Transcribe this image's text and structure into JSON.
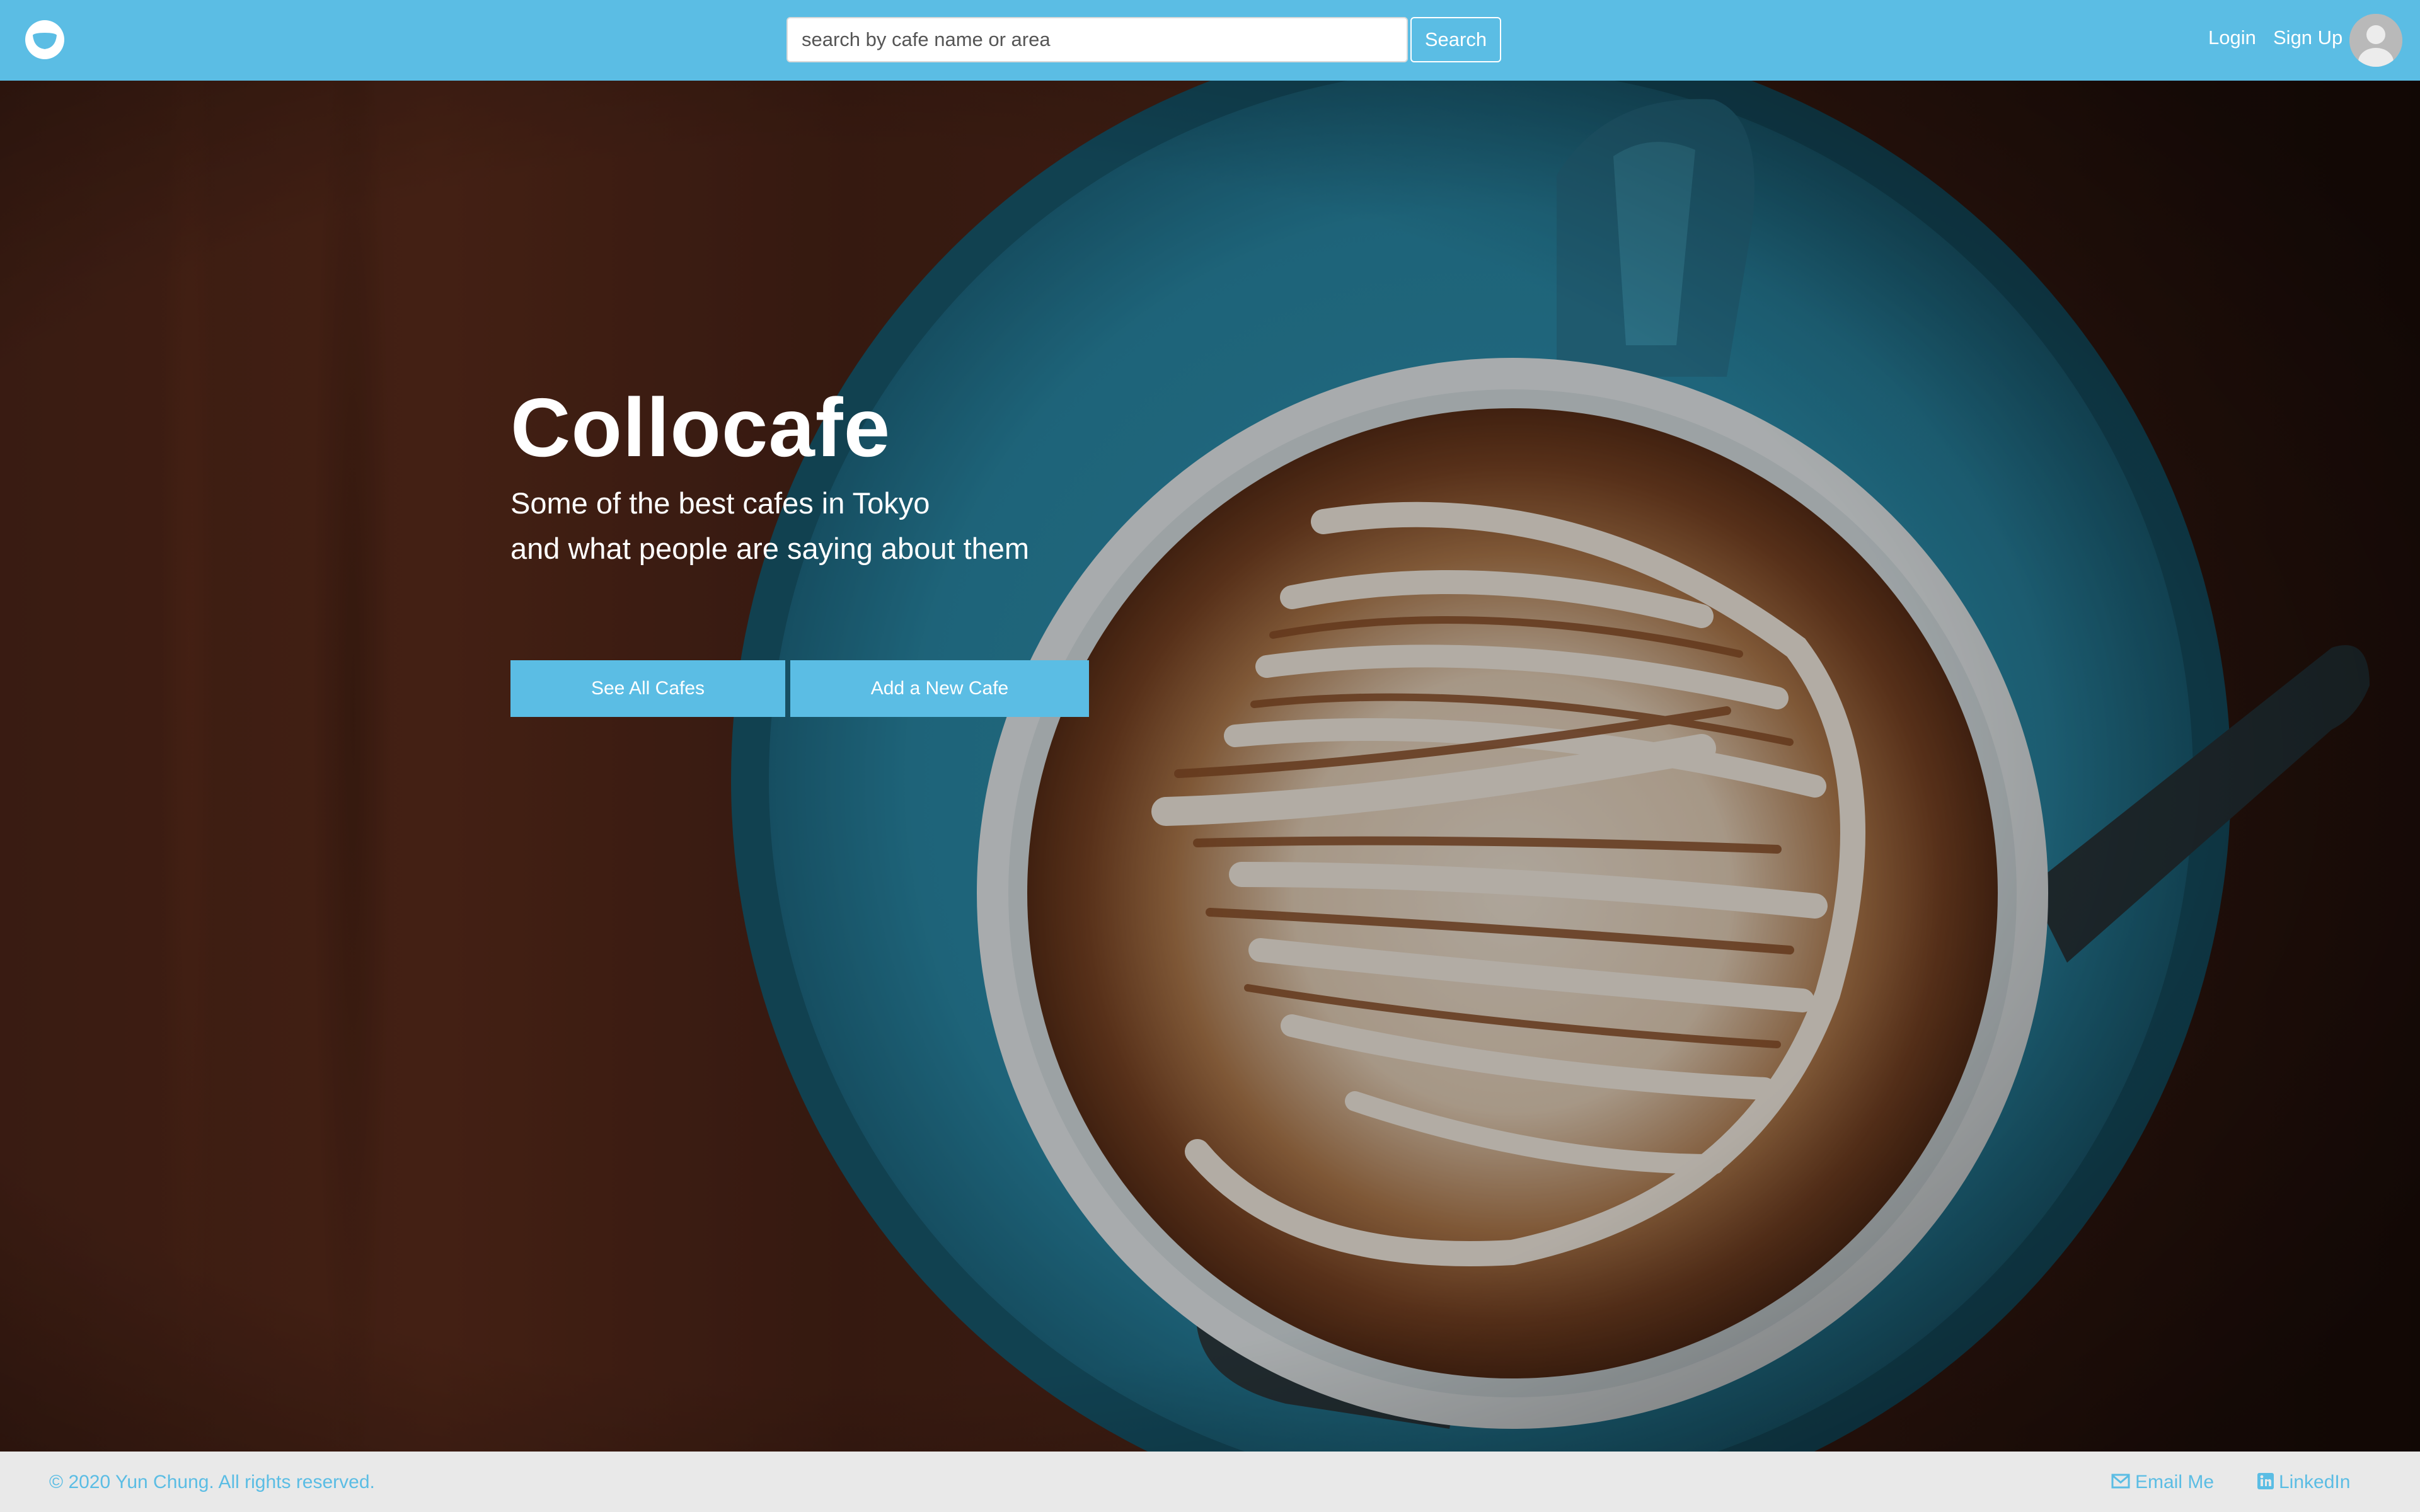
{
  "navbar": {
    "logo_icon": "coffee-cup-icon",
    "search": {
      "placeholder": "search by cafe name or area",
      "value": "",
      "button_label": "Search"
    },
    "login_label": "Login",
    "signup_label": "Sign Up",
    "avatar_icon": "user-avatar-icon"
  },
  "hero": {
    "background": "latte-art-coffee-cup-photo",
    "title": "Collocafe",
    "subtitle_line1": "Some of the best cafes in Tokyo",
    "subtitle_line2": "and what people are saying about them",
    "see_all_label": "See All Cafes",
    "add_new_label": "Add a New Cafe"
  },
  "footer": {
    "copyright": "© 2020 Yun Chung. All rights reserved.",
    "email_label": "Email Me",
    "email_icon": "envelope-icon",
    "linkedin_label": "LinkedIn",
    "linkedin_icon": "linkedin-icon"
  },
  "colors": {
    "accent": "#5bbde4",
    "footer_bg": "#e9e9e9",
    "text_on_accent": "#ffffff"
  }
}
